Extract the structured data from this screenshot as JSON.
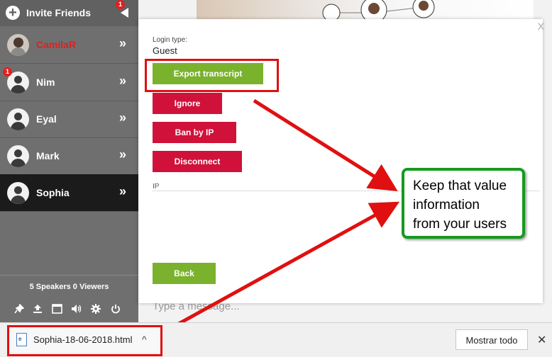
{
  "sidebar": {
    "invite_label": "Invite Friends",
    "invite_badge": "1",
    "users": [
      {
        "name": "CamilaR",
        "color": "#e02020",
        "badge": ""
      },
      {
        "name": "Nim",
        "color": "#ffffff",
        "badge": "1"
      },
      {
        "name": "Eyal",
        "color": "#ffffff",
        "badge": ""
      },
      {
        "name": "Mark",
        "color": "#ffffff",
        "badge": ""
      },
      {
        "name": "Sophia",
        "color": "#ffffff",
        "badge": "",
        "active": true
      }
    ],
    "chevron": "»",
    "stats": {
      "speakers_count": "5",
      "speakers_label": "Speakers",
      "viewers_count": "0",
      "viewers_label": "Viewers"
    },
    "toolbar_icons": [
      "pin-icon",
      "upload-icon",
      "window-icon",
      "volume-icon",
      "gear-icon",
      "power-icon"
    ]
  },
  "modal": {
    "close": "X",
    "login_type_label": "Login type:",
    "login_type_value": "Guest",
    "buttons": {
      "export": "Export transcript",
      "ignore": "Ignore",
      "ban": "Ban by IP",
      "disconnect": "Disconnect",
      "back": "Back"
    },
    "ip_label": "IP"
  },
  "chat": {
    "message_placeholder": "Type a message..."
  },
  "annotation": {
    "callout_lines": [
      "Keep that value",
      "information",
      "from your users"
    ],
    "highlight_color": "#e01010",
    "callout_border": "#179a1f"
  },
  "download_bar": {
    "file_name": "Sophia-18-06-2018.html",
    "show_all": "Mostrar todo",
    "close": "✕"
  },
  "colors": {
    "green": "#7ab22e",
    "red": "#d0123a",
    "sidebar": "#6f6f6f"
  }
}
